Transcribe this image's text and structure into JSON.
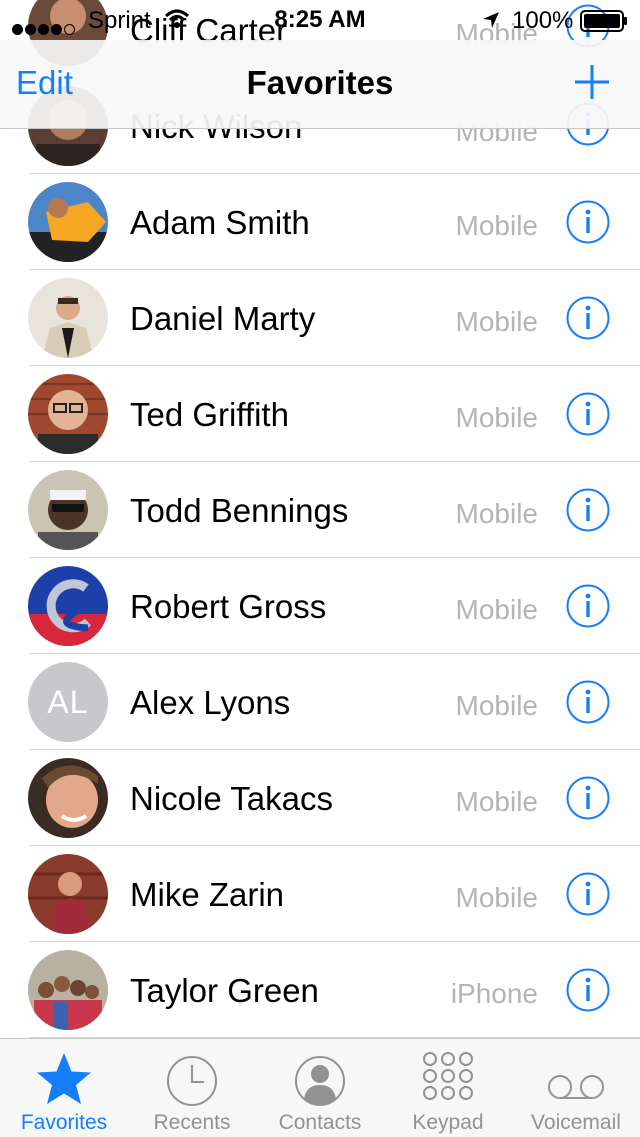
{
  "status_bar": {
    "carrier": "Sprint",
    "time": "8:25 AM",
    "battery": "100%"
  },
  "nav": {
    "edit_label": "Edit",
    "title": "Favorites"
  },
  "favorites": [
    {
      "name": "Cliff Carter",
      "type": "Mobile"
    },
    {
      "name": "Nick Wilson",
      "type": "Mobile"
    },
    {
      "name": "Adam Smith",
      "type": "Mobile"
    },
    {
      "name": "Daniel Marty",
      "type": "Mobile"
    },
    {
      "name": "Ted Griffith",
      "type": "Mobile"
    },
    {
      "name": "Todd Bennings",
      "type": "Mobile"
    },
    {
      "name": "Robert Gross",
      "type": "Mobile"
    },
    {
      "name": "Alex Lyons",
      "type": "Mobile",
      "initials": "AL"
    },
    {
      "name": "Nicole Takacs",
      "type": "Mobile"
    },
    {
      "name": "Mike Zarin",
      "type": "Mobile"
    },
    {
      "name": "Taylor Green",
      "type": "iPhone"
    }
  ],
  "tabs": [
    {
      "label": "Favorites",
      "icon": "star-icon",
      "active": true
    },
    {
      "label": "Recents",
      "icon": "clock-icon",
      "active": false
    },
    {
      "label": "Contacts",
      "icon": "person-icon",
      "active": false
    },
    {
      "label": "Keypad",
      "icon": "keypad-icon",
      "active": false
    },
    {
      "label": "Voicemail",
      "icon": "voicemail-icon",
      "active": false
    }
  ],
  "colors": {
    "accent": "#157efb",
    "secondary_text": "#b4b4b4",
    "tab_inactive": "#929292"
  }
}
